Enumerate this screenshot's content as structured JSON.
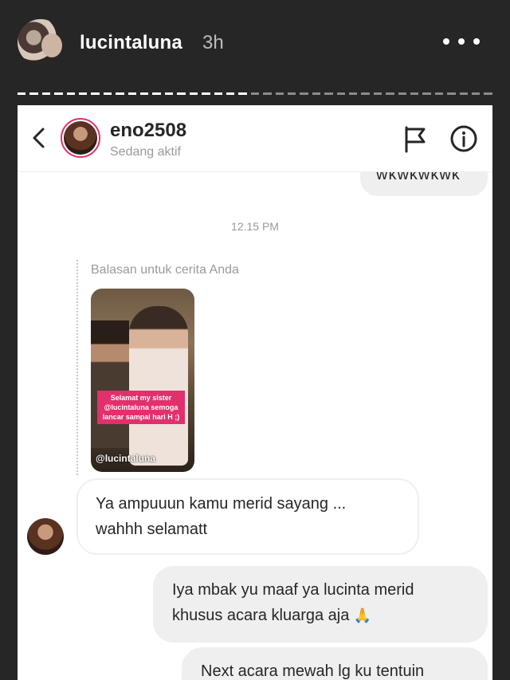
{
  "story": {
    "username": "lucintaluna",
    "time": "3h",
    "more_icon": "more-horizontal-icon"
  },
  "dm": {
    "username": "eno2508",
    "status": "Sedang aktif",
    "previous_message": "wkwkwkwk",
    "timestamp": "12.15 PM",
    "reply_label": "Balasan untuk cerita Anda",
    "story_preview": {
      "caption": "Selamat my sister @lucintaluna semoga lancar sampai hari H ;)",
      "mention": "@lucintaluna"
    },
    "messages": [
      {
        "from": "them",
        "text": "Ya ampuuun kamu merid sayang ...\nwahhh selamatt"
      },
      {
        "from": "me",
        "text": "Iya mbak yu maaf ya lucinta merid\nkhusus acara kluarga aja",
        "emoji": "🙏"
      },
      {
        "from": "me",
        "text": "Next acara mewah lg ku tentuin"
      }
    ]
  },
  "colors": {
    "story_bg": "#262626",
    "bubble_out": "#efefef",
    "caption_pink": "#e1306c"
  }
}
